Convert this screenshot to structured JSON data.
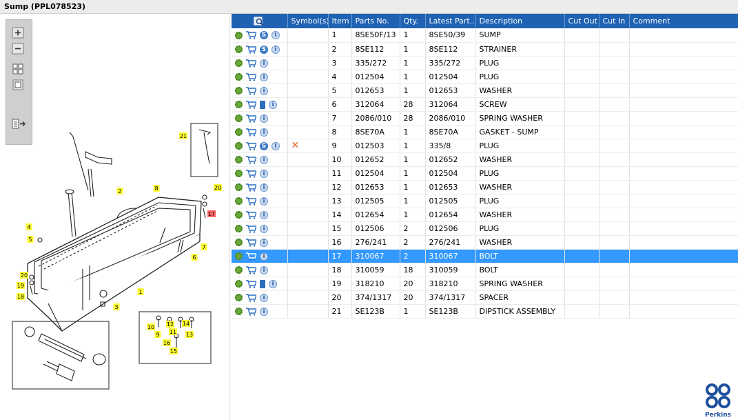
{
  "window": {
    "title": "Sump (PPL078523)"
  },
  "toolbox": [
    {
      "name": "zoom-in-icon",
      "glyph": "+"
    },
    {
      "name": "zoom-out-icon",
      "glyph": "−"
    },
    {
      "name": "fit-grid-icon",
      "glyph": "▦"
    },
    {
      "name": "actual-size-icon",
      "glyph": "□"
    },
    {
      "name": "export-icon",
      "glyph": "⇥"
    }
  ],
  "diagram": {
    "callouts": [
      "1",
      "2",
      "3",
      "4",
      "5",
      "6",
      "7",
      "8",
      "9",
      "10",
      "11",
      "12",
      "13",
      "14",
      "15",
      "16",
      "17",
      "18",
      "19",
      "20",
      "21",
      "20",
      "19",
      "18"
    ]
  },
  "table": {
    "headers": [
      "Symbol(s)",
      "Item",
      "Parts No.",
      "Qty.",
      "Latest Part...",
      "Description",
      "Cut Out",
      "Cut In",
      "Comment"
    ],
    "rows": [
      {
        "item": "1",
        "parts_no": "8SE50F/13",
        "qty": "1",
        "latest": "8SE50/39",
        "desc": "SUMP",
        "s": true,
        "book": false,
        "x": false
      },
      {
        "item": "2",
        "parts_no": "8SE112",
        "qty": "1",
        "latest": "8SE112",
        "desc": "STRAINER",
        "s": true,
        "book": false,
        "x": false
      },
      {
        "item": "3",
        "parts_no": "335/272",
        "qty": "1",
        "latest": "335/272",
        "desc": "PLUG",
        "s": false,
        "book": false,
        "x": false
      },
      {
        "item": "4",
        "parts_no": "012504",
        "qty": "1",
        "latest": "012504",
        "desc": "PLUG",
        "s": false,
        "book": false,
        "x": false
      },
      {
        "item": "5",
        "parts_no": "012653",
        "qty": "1",
        "latest": "012653",
        "desc": "WASHER",
        "s": false,
        "book": false,
        "x": false
      },
      {
        "item": "6",
        "parts_no": "312064",
        "qty": "28",
        "latest": "312064",
        "desc": "SCREW",
        "s": false,
        "book": true,
        "x": false
      },
      {
        "item": "7",
        "parts_no": "2086/010",
        "qty": "28",
        "latest": "2086/010",
        "desc": "SPRING WASHER",
        "s": false,
        "book": false,
        "x": false
      },
      {
        "item": "8",
        "parts_no": "8SE70A",
        "qty": "1",
        "latest": "8SE70A",
        "desc": "GASKET - SUMP",
        "s": false,
        "book": false,
        "x": false
      },
      {
        "item": "9",
        "parts_no": "012503",
        "qty": "1",
        "latest": "335/8",
        "desc": "PLUG",
        "s": true,
        "book": false,
        "x": true
      },
      {
        "item": "10",
        "parts_no": "012652",
        "qty": "1",
        "latest": "012652",
        "desc": "WASHER",
        "s": false,
        "book": false,
        "x": false
      },
      {
        "item": "11",
        "parts_no": "012504",
        "qty": "1",
        "latest": "012504",
        "desc": "PLUG",
        "s": false,
        "book": false,
        "x": false
      },
      {
        "item": "12",
        "parts_no": "012653",
        "qty": "1",
        "latest": "012653",
        "desc": "WASHER",
        "s": false,
        "book": false,
        "x": false
      },
      {
        "item": "13",
        "parts_no": "012505",
        "qty": "1",
        "latest": "012505",
        "desc": "PLUG",
        "s": false,
        "book": false,
        "x": false
      },
      {
        "item": "14",
        "parts_no": "012654",
        "qty": "1",
        "latest": "012654",
        "desc": "WASHER",
        "s": false,
        "book": false,
        "x": false
      },
      {
        "item": "15",
        "parts_no": "012506",
        "qty": "2",
        "latest": "012506",
        "desc": "PLUG",
        "s": false,
        "book": false,
        "x": false
      },
      {
        "item": "16",
        "parts_no": "276/241",
        "qty": "2",
        "latest": "276/241",
        "desc": "WASHER",
        "s": false,
        "book": false,
        "x": false
      },
      {
        "item": "17",
        "parts_no": "310067",
        "qty": "2",
        "latest": "310067",
        "desc": "BOLT",
        "s": false,
        "book": false,
        "x": false,
        "selected": true
      },
      {
        "item": "18",
        "parts_no": "310059",
        "qty": "18",
        "latest": "310059",
        "desc": "BOLT",
        "s": false,
        "book": false,
        "x": false
      },
      {
        "item": "19",
        "parts_no": "318210",
        "qty": "20",
        "latest": "318210",
        "desc": "SPRING WASHER",
        "s": false,
        "book": true,
        "x": false
      },
      {
        "item": "20",
        "parts_no": "374/1317",
        "qty": "20",
        "latest": "374/1317",
        "desc": "SPACER",
        "s": false,
        "book": false,
        "x": false
      },
      {
        "item": "21",
        "parts_no": "SE123B",
        "qty": "1",
        "latest": "SE123B",
        "desc": "DIPSTICK ASSEMBLY",
        "s": false,
        "book": false,
        "x": false
      }
    ]
  },
  "logo": {
    "text": "Perkins"
  },
  "colors": {
    "header": "#1f62b3",
    "selected": "#3399ff",
    "callout": "#ffff33",
    "callout_selected": "#ff6666"
  }
}
